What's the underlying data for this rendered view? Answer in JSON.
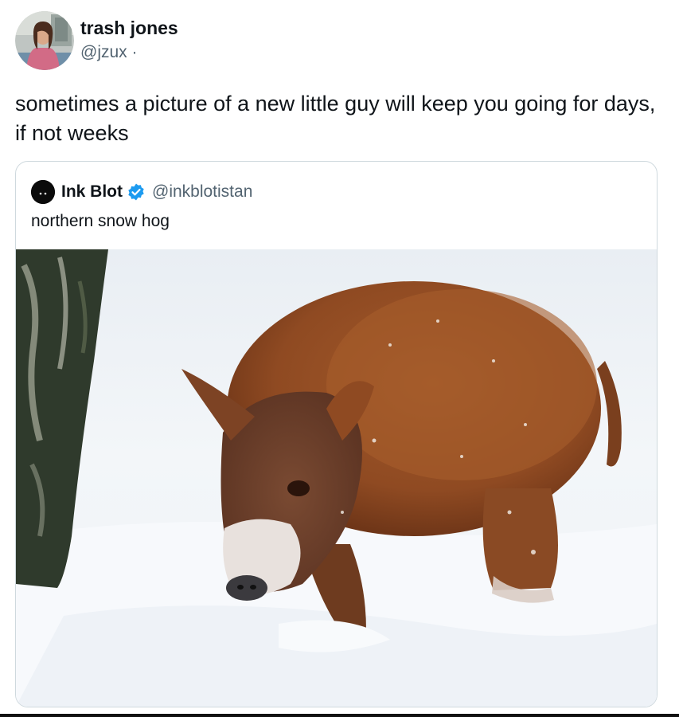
{
  "tweet": {
    "author": {
      "display_name": "trash jones",
      "handle_line": "@jzux ·",
      "avatar_icon": "user-photo-avatar"
    },
    "text": "sometimes a picture of a new little guy will keep you going for days, if not weeks"
  },
  "quote": {
    "author": {
      "display_name": "Ink Blot",
      "handle": "@inkblotistan",
      "verified": true,
      "verified_color": "#1d9bf0",
      "avatar_icon": "ink-blot-avatar"
    },
    "text": "northern snow hog",
    "media": {
      "icon": "photo-of-furry-pig-in-snow"
    }
  },
  "colors": {
    "text_primary": "#0f1419",
    "text_secondary": "#536471",
    "card_border": "#cfd9de"
  }
}
